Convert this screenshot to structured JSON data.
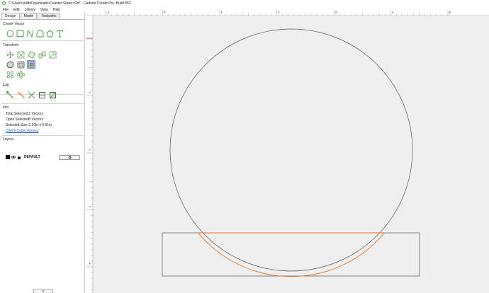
{
  "window": {
    "title": "C:\\Users\\willb\\Downloads\\Coaster Stand.c2d* - Carbide Create Pro. Build 853"
  },
  "menu": [
    {
      "label": "File"
    },
    {
      "label": "Edit"
    },
    {
      "label": "Library"
    },
    {
      "label": "View"
    },
    {
      "label": "Help"
    }
  ],
  "tabs": [
    {
      "label": "Design",
      "active": true
    },
    {
      "label": "Model"
    },
    {
      "label": "Toolpaths"
    }
  ],
  "sections": {
    "create_vector": "Create Vector",
    "transform": "Transform",
    "edit": "Edit",
    "info": "Info",
    "layers": "Layers"
  },
  "create_vector_tools": [
    {
      "icon": "circle-icon"
    },
    {
      "icon": "rectangle-icon"
    },
    {
      "icon": "polyline-icon"
    },
    {
      "icon": "curve-icon"
    },
    {
      "icon": "polygon-icon"
    },
    {
      "icon": "text-icon"
    }
  ],
  "info": {
    "total_selected_label": "Total Selected:",
    "total_selected_value": "1 Vectors",
    "open_selected_label": "Open Selected:",
    "open_selected_value": "0 Vectors",
    "selected_size_label": "Selected Size:",
    "selected_size_value": "3.10in x 0.61in",
    "check_cutter_label": "Check Cutter Access"
  },
  "layers": [
    {
      "name": "DEFAULT",
      "color": "#000000"
    }
  ],
  "bottom_button": {
    "label": "»"
  },
  "ruler": {
    "x_labels": [
      "-1",
      "0",
      "1",
      "2",
      "3",
      "4",
      "5"
    ],
    "y_labels": [
      "-1",
      "-2",
      "-3",
      "-4"
    ]
  },
  "colors": {
    "accent_green": "#4a9a44",
    "selection_orange": "#e8711c",
    "canvas_bg": "#efefef",
    "link_blue": "#1a56c4"
  }
}
